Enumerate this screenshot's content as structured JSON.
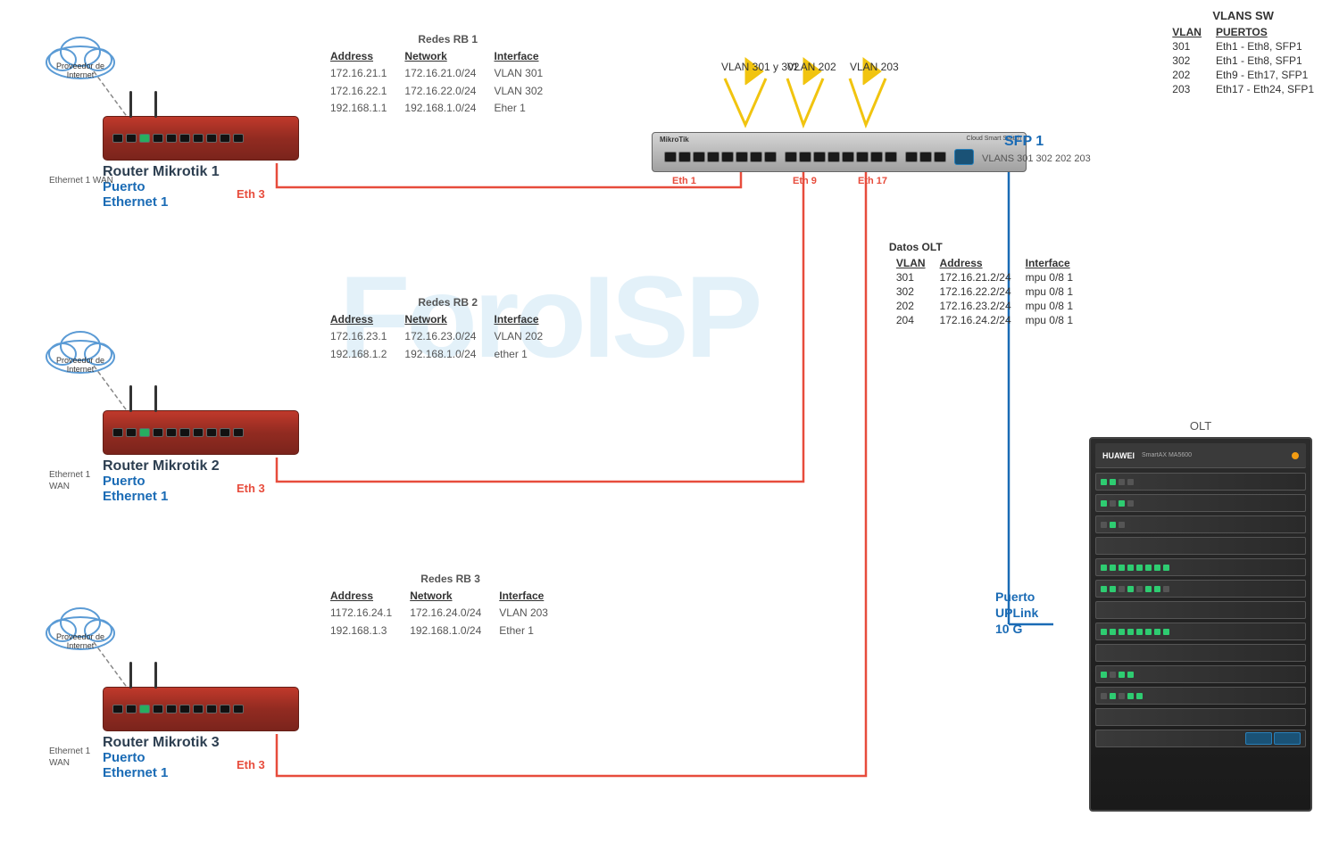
{
  "watermark": "ForoISP",
  "vlan_table": {
    "title": "VLANS SW",
    "headers": [
      "VLAN",
      "PUERTOS"
    ],
    "rows": [
      {
        "vlan": "301",
        "puertos": "Eth1 - Eth8, SFP1"
      },
      {
        "vlan": "302",
        "puertos": "Eth1 - Eth8, SFP1"
      },
      {
        "vlan": "202",
        "puertos": "Eth9 - Eth17, SFP1"
      },
      {
        "vlan": "203",
        "puertos": "Eth17 - Eth24, SFP1"
      }
    ]
  },
  "router1": {
    "title": "Router Mikrotik 1",
    "puerto_label": "Puerto\nEthernet 1",
    "eth_wan": "Ethernet 1\nWAN",
    "eth3_label": "Eth 3",
    "redes_title": "Redes RB 1",
    "address_header": "Address",
    "addresses": [
      "172.16.21.1",
      "172.16.22.1",
      "192.168.1.1"
    ],
    "network_header": "Network",
    "networks": [
      "172.16.21.0/24",
      "172.16.22.0/24",
      "192.168.1.0/24"
    ],
    "interface_header": "Interface",
    "interfaces": [
      "VLAN 301",
      "VLAN 302",
      "Eher 1"
    ]
  },
  "router2": {
    "title": "Router Mikrotik 2",
    "puerto_label": "Puerto\nEthernet 1",
    "eth_wan": "Ethernet 1\nWAN",
    "eth3_label": "Eth 3",
    "redes_title": "Redes RB 2",
    "address_header": "Address",
    "addresses": [
      "172.16.23.1",
      "192.168.1.2"
    ],
    "network_header": "Network",
    "networks": [
      "172.16.23.0/24",
      "192.168.1.0/24"
    ],
    "interface_header": "Interface",
    "interfaces": [
      "VLAN 202",
      "ether 1"
    ]
  },
  "router3": {
    "title": "Router Mikrotik 3",
    "puerto_label": "Puerto\nEthernet 1",
    "eth_wan": "Ethernet 1\nWAN",
    "eth3_label": "Eth 3",
    "redes_title": "Redes RB 3",
    "address_header": "Address",
    "addresses": [
      "1172.16.24.1",
      "192.168.1.3"
    ],
    "network_header": "Network",
    "networks": [
      "172.16.24.0/24",
      "192.168.1.0/24"
    ],
    "interface_header": "Interface",
    "interfaces": [
      "VLAN 203",
      "Ether 1"
    ]
  },
  "switch": {
    "label": "Cloud Smart Switch",
    "logo": "MikroTik",
    "eth1_label": "Eth 1",
    "eth9_label": "Eth 9",
    "eth17_label": "Eth 17",
    "sfp1_label": "SFP 1",
    "sfp1_vlans": "VLANS 301 302 202 203"
  },
  "vlan_labels": {
    "vlan301_302": "VLAN 301 y 302",
    "vlan202": "VLAN 202",
    "vlan203": "VLAN 203"
  },
  "olt": {
    "label": "OLT",
    "brand": "HUAWEI",
    "model": "SmartAX MA5600",
    "uplink_label": "Puerto\nUPLink\n10 G",
    "datos_title": "Datos OLT",
    "vlan_header": "VLAN",
    "address_header": "Address",
    "interface_header": "Interface",
    "rows": [
      {
        "vlan": "301",
        "address": "172.16.21.2/24",
        "interface": "mpu 0/8 1"
      },
      {
        "vlan": "302",
        "address": "172.16.22.2/24",
        "interface": "mpu 0/8 1"
      },
      {
        "vlan": "202",
        "address": "172.16.23.2/24",
        "interface": "mpu 0/8 1"
      },
      {
        "vlan": "204",
        "address": "172.16.24.2/24",
        "interface": "mpu 0/8 1"
      }
    ]
  }
}
